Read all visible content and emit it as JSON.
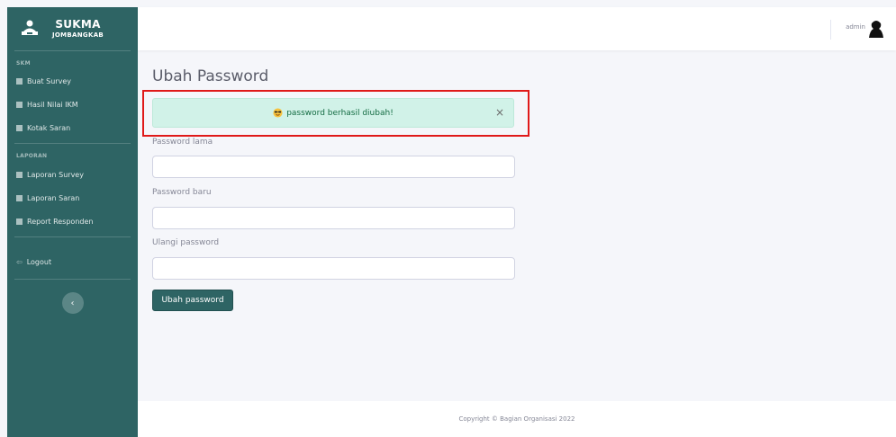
{
  "brand": {
    "title": "SUKMA",
    "subtitle": "JOMBANGKAB",
    "icon": "person-laptop-icon"
  },
  "sidebar": {
    "sections": [
      {
        "heading": "SKM",
        "items": [
          {
            "label": "Buat Survey",
            "icon": "book-icon"
          },
          {
            "label": "Hasil Nilai IKM",
            "icon": "chart-icon"
          },
          {
            "label": "Kotak Saran",
            "icon": "inbox-icon"
          }
        ]
      },
      {
        "heading": "LAPORAN",
        "items": [
          {
            "label": "Laporan Survey",
            "icon": "report-icon"
          },
          {
            "label": "Laporan Saran",
            "icon": "document-icon"
          },
          {
            "label": "Report Responden",
            "icon": "users-icon"
          }
        ]
      }
    ],
    "logout_label": "Logout",
    "toggle_icon": "chevron-left-icon",
    "toggle_glyph": "‹"
  },
  "topbar": {
    "user_name": "admin",
    "avatar_icon": "user-avatar-icon"
  },
  "page": {
    "title": "Ubah Password",
    "alert": {
      "message": "password berhasil diubah!",
      "icon": "emoji-cool-icon",
      "close_glyph": "×",
      "color": "#d1f2e8"
    },
    "form": {
      "old_label": "Password lama",
      "new_label": "Password baru",
      "repeat_label": "Ulangi password",
      "old_value": "",
      "new_value": "",
      "repeat_value": "",
      "submit_label": "Ubah password"
    }
  },
  "footer": {
    "text": "Copyright © Bagian Organisasi 2022"
  },
  "colors": {
    "accent": "#2e6464",
    "highlight": "#e01919"
  }
}
